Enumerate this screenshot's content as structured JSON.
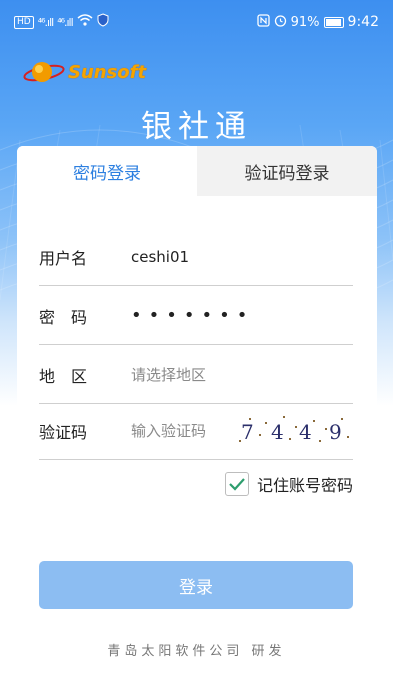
{
  "status_bar": {
    "left_badge": "HD",
    "signal1": "⁴⁶.ıll",
    "signal2": "⁴⁶.ıll",
    "battery_pct": "91%",
    "time": "9:42"
  },
  "brand": {
    "logo_text": "Sunsoft",
    "app_title": "银社通"
  },
  "tabs": [
    {
      "label": "密码登录",
      "active": true
    },
    {
      "label": "验证码登录",
      "active": false
    }
  ],
  "form": {
    "username": {
      "label": "用户名",
      "value": "ceshi01"
    },
    "password": {
      "label": "密　码",
      "value": "•••••••"
    },
    "region": {
      "label": "地　区",
      "placeholder": "请选择地区"
    },
    "captcha": {
      "label": "验证码",
      "placeholder": "输入验证码",
      "code": [
        "7",
        "4",
        "4",
        "9"
      ]
    },
    "remember_label": "记住账号密码",
    "remember_checked": true
  },
  "login_button": "登录",
  "footer": "青岛太阳软件公司 研发",
  "colors": {
    "accent": "#2c7fe0",
    "button_bg": "#8cbdf2",
    "check": "#2e9e6e"
  }
}
